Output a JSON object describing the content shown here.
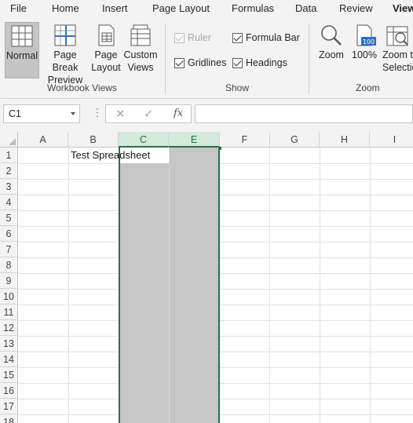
{
  "ribbon_tabs": [
    "File",
    "Home",
    "Insert",
    "Page Layout",
    "Formulas",
    "Data",
    "Review",
    "View"
  ],
  "active_tab": "View",
  "workbook_views": {
    "group_label": "Workbook Views",
    "normal": "Normal",
    "page_break_1": "Page Break",
    "page_break_2": "Preview",
    "page_layout_1": "Page",
    "page_layout_2": "Layout",
    "custom_views_1": "Custom",
    "custom_views_2": "Views"
  },
  "show": {
    "group_label": "Show",
    "ruler": "Ruler",
    "gridlines": "Gridlines",
    "formula_bar": "Formula Bar",
    "headings": "Headings"
  },
  "zoom": {
    "group_label": "Zoom",
    "zoom": "Zoom",
    "hundred": "100%",
    "hundred_icon": "100",
    "zoom_to_1": "Zoom to",
    "zoom_to_2": "Selection"
  },
  "formula_bar": {
    "name_box": "C1",
    "fx": "fx",
    "cancel": "✕",
    "enter": "✓",
    "dots": "⋮",
    "value": ""
  },
  "sheet": {
    "columns": [
      "A",
      "B",
      "C",
      "E",
      "F",
      "G",
      "H",
      "I"
    ],
    "rows": [
      "1",
      "2",
      "3",
      "4",
      "5",
      "6",
      "7",
      "8",
      "9",
      "10",
      "11",
      "12",
      "13",
      "14",
      "15",
      "16",
      "17",
      "18"
    ],
    "b1": "Test Spreadsheet"
  },
  "colors": {
    "accent": "#217346",
    "selection_fill": "#c6c6c6",
    "ribbon_bg": "#f3f3f3"
  }
}
